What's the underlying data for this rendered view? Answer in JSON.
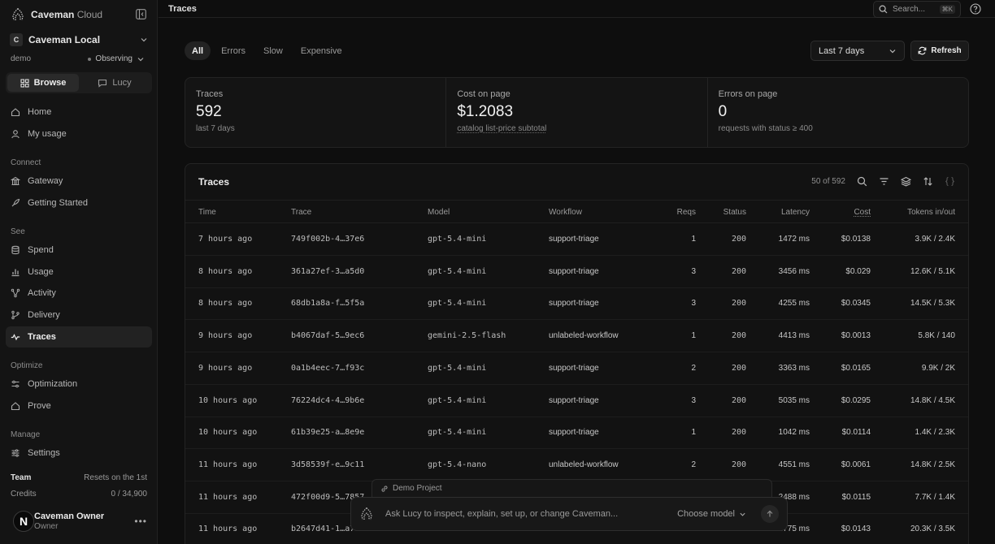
{
  "sidebar": {
    "brand": {
      "name": "Caveman",
      "sub": "Cloud"
    },
    "org": {
      "initial": "C",
      "name": "Caveman Local"
    },
    "env": {
      "name": "demo",
      "status": "Observing"
    },
    "modes": {
      "browse": "Browse",
      "lucy": "Lucy"
    },
    "main_items": [
      {
        "label": "Home",
        "icon": "home-icon"
      },
      {
        "label": "My usage",
        "icon": "user-icon"
      }
    ],
    "sections": {
      "connect": "Connect",
      "see": "See",
      "optimize": "Optimize",
      "manage": "Manage"
    },
    "connect_items": [
      {
        "label": "Gateway",
        "icon": "gateway-icon"
      },
      {
        "label": "Getting Started",
        "icon": "rocket-icon"
      }
    ],
    "see_items": [
      {
        "label": "Spend",
        "icon": "database-icon"
      },
      {
        "label": "Usage",
        "icon": "bar-chart-icon"
      },
      {
        "label": "Activity",
        "icon": "activity-icon"
      },
      {
        "label": "Delivery",
        "icon": "branch-icon"
      },
      {
        "label": "Traces",
        "icon": "traces-icon"
      }
    ],
    "optimize_items": [
      {
        "label": "Optimization",
        "icon": "sliders-icon"
      },
      {
        "label": "Prove",
        "icon": "home-icon"
      }
    ],
    "manage_items": [
      {
        "label": "Settings",
        "icon": "settings-icon"
      }
    ],
    "team": {
      "label": "Team",
      "reset": "Resets on the 1st"
    },
    "credits": {
      "label": "Credits",
      "value": "0 / 34,900"
    },
    "user": {
      "initial": "N",
      "name": "Caveman Owner",
      "role": "Owner"
    }
  },
  "topbar": {
    "title": "Traces",
    "search_placeholder": "Search...",
    "shortcut": "⌘K"
  },
  "filters": {
    "tabs": [
      "All",
      "Errors",
      "Slow",
      "Expensive"
    ],
    "active_tab": "All",
    "range": "Last 7 days",
    "refresh": "Refresh"
  },
  "stats": [
    {
      "label": "Traces",
      "value": "592",
      "sub": "last 7 days"
    },
    {
      "label": "Cost on page",
      "value": "$1.2083",
      "sub": "catalog list-price subtotal"
    },
    {
      "label": "Errors on page",
      "value": "0",
      "sub": "requests with status ≥ 400"
    }
  ],
  "table": {
    "title": "Traces",
    "count": "50 of 592",
    "columns": {
      "time": "Time",
      "trace": "Trace",
      "model": "Model",
      "workflow": "Workflow",
      "reqs": "Reqs",
      "status": "Status",
      "latency": "Latency",
      "cost": "Cost",
      "tokens": "Tokens in/out"
    },
    "rows": [
      {
        "time": "7 hours ago",
        "trace": "749f002b-4…37e6",
        "model": "gpt-5.4-mini",
        "workflow": "support-triage",
        "reqs": "1",
        "status": "200",
        "latency": "1472 ms",
        "cost": "$0.0138",
        "tokens": "3.9K / 2.4K"
      },
      {
        "time": "8 hours ago",
        "trace": "361a27ef-3…a5d0",
        "model": "gpt-5.4-mini",
        "workflow": "support-triage",
        "reqs": "3",
        "status": "200",
        "latency": "3456 ms",
        "cost": "$0.029",
        "tokens": "12.6K / 5.1K"
      },
      {
        "time": "8 hours ago",
        "trace": "68db1a8a-f…5f5a",
        "model": "gpt-5.4-mini",
        "workflow": "support-triage",
        "reqs": "3",
        "status": "200",
        "latency": "4255 ms",
        "cost": "$0.0345",
        "tokens": "14.5K / 5.3K"
      },
      {
        "time": "9 hours ago",
        "trace": "b4067daf-5…9ec6",
        "model": "gemini-2.5-flash",
        "workflow": "unlabeled-workflow",
        "reqs": "1",
        "status": "200",
        "latency": "4413 ms",
        "cost": "$0.0013",
        "tokens": "5.8K / 140"
      },
      {
        "time": "9 hours ago",
        "trace": "0a1b4eec-7…f93c",
        "model": "gpt-5.4-mini",
        "workflow": "support-triage",
        "reqs": "2",
        "status": "200",
        "latency": "3363 ms",
        "cost": "$0.0165",
        "tokens": "9.9K / 2K"
      },
      {
        "time": "10 hours ago",
        "trace": "76224dc4-4…9b6e",
        "model": "gpt-5.4-mini",
        "workflow": "support-triage",
        "reqs": "3",
        "status": "200",
        "latency": "5035 ms",
        "cost": "$0.0295",
        "tokens": "14.8K / 4.5K"
      },
      {
        "time": "10 hours ago",
        "trace": "61b39e25-a…8e9e",
        "model": "gpt-5.4-mini",
        "workflow": "support-triage",
        "reqs": "1",
        "status": "200",
        "latency": "1042 ms",
        "cost": "$0.0114",
        "tokens": "1.4K / 2.3K"
      },
      {
        "time": "11 hours ago",
        "trace": "3d58539f-e…9c11",
        "model": "gpt-5.4-nano",
        "workflow": "unlabeled-workflow",
        "reqs": "2",
        "status": "200",
        "latency": "4551 ms",
        "cost": "$0.0061",
        "tokens": "14.8K / 2.5K"
      },
      {
        "time": "11 hours ago",
        "trace": "472f00d9-5…7857",
        "model": "",
        "workflow": "",
        "reqs": "",
        "status": "",
        "latency": "2488 ms",
        "cost": "$0.0115",
        "tokens": "7.7K / 1.4K"
      },
      {
        "time": "11 hours ago",
        "trace": "b2647d41-1…a7c6",
        "model": "",
        "workflow": "",
        "reqs": "",
        "status": "",
        "latency": "4775 ms",
        "cost": "$0.0143",
        "tokens": "20.3K / 3.5K"
      }
    ]
  },
  "lucy": {
    "project": "Demo Project",
    "placeholder": "Ask Lucy to inspect, explain, set up, or change Caveman...",
    "model_select": "Choose model"
  },
  "colors": {
    "background": "#0e0e0e",
    "sidebar": "#141414",
    "status_ok": "#6cc77a"
  }
}
